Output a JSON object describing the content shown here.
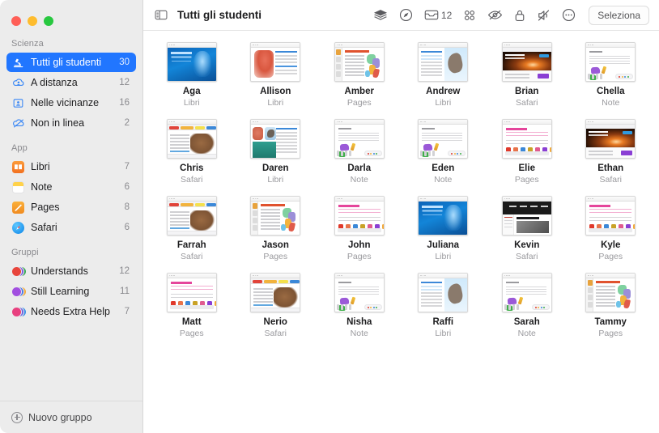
{
  "window": {
    "traffic_lights": [
      "close",
      "minimize",
      "zoom"
    ],
    "colors": {
      "accent": "#2176ff",
      "sidebar_bg": "#ececec",
      "main_bg": "#ffffff"
    }
  },
  "toolbar": {
    "sidebar_toggle_icon": "sidebar-icon",
    "title": "Tutti gli studenti",
    "actions": [
      {
        "icon": "layers-icon",
        "name": "layers-button",
        "label": ""
      },
      {
        "icon": "navigate-icon",
        "name": "navigate-button",
        "label": ""
      },
      {
        "icon": "inbox-icon",
        "name": "inbox-button",
        "label": "12"
      },
      {
        "icon": "grid-apps-icon",
        "name": "apps-button",
        "label": ""
      },
      {
        "icon": "eye-slash-icon",
        "name": "hide-screen-button",
        "label": ""
      },
      {
        "icon": "lock-icon",
        "name": "lock-button",
        "label": ""
      },
      {
        "icon": "mute-icon",
        "name": "mute-button",
        "label": ""
      },
      {
        "icon": "more-circle-icon",
        "name": "more-button",
        "label": ""
      }
    ],
    "select_label": "Seleziona"
  },
  "sidebar": {
    "sections": [
      {
        "title": "Scienza",
        "items": [
          {
            "icon": "microscope-icon",
            "label": "Tutti gli studenti",
            "count": "30",
            "selected": true
          },
          {
            "icon": "cloud-person-icon",
            "label": "A distanza",
            "count": "12",
            "selected": false
          },
          {
            "icon": "person-card-icon",
            "label": "Nelle vicinanze",
            "count": "16",
            "selected": false
          },
          {
            "icon": "cloud-slash-icon",
            "label": "Non in linea",
            "count": "2",
            "selected": false
          }
        ]
      },
      {
        "title": "App",
        "items": [
          {
            "icon": "books-app-icon",
            "label": "Libri",
            "count": "7",
            "color": "#f3782b",
            "selected": false
          },
          {
            "icon": "notes-app-icon",
            "label": "Note",
            "count": "6",
            "color": "#ffcc33",
            "selected": false
          },
          {
            "icon": "pages-app-icon",
            "label": "Pages",
            "count": "8",
            "color": "#f3932b",
            "selected": false
          },
          {
            "icon": "safari-app-icon",
            "label": "Safari",
            "count": "6",
            "color": "#1a8cf0",
            "selected": false
          }
        ]
      },
      {
        "title": "Gruppi",
        "items": [
          {
            "icon": "group-avatars-icon",
            "label": "Understands",
            "count": "12",
            "colors": [
              "#e8453c",
              "#7d5be0",
              "#3aa757"
            ],
            "selected": false
          },
          {
            "icon": "group-avatars-icon",
            "label": "Still Learning",
            "count": "11",
            "colors": [
              "#a24fe0",
              "#4a7be8",
              "#f2a93b"
            ],
            "selected": false
          },
          {
            "icon": "group-avatars-icon",
            "label": "Needs Extra Help",
            "count": "7",
            "colors": [
              "#e8407f",
              "#6b63e0",
              "#3c8fe8"
            ],
            "selected": false
          }
        ]
      }
    ],
    "footer": {
      "icon": "plus-circle-icon",
      "label": "Nuovo gruppo"
    }
  },
  "students": [
    {
      "name": "Aga",
      "app": "Libri",
      "art": "art-books-penguin"
    },
    {
      "name": "Allison",
      "app": "Libri",
      "art": "art-books-flam"
    },
    {
      "name": "Amber",
      "app": "Pages",
      "art": "art-pages-map"
    },
    {
      "name": "Andrew",
      "app": "Libri",
      "art": "art-books-dino"
    },
    {
      "name": "Brian",
      "app": "Safari",
      "art": "art-safari-dark"
    },
    {
      "name": "Chella",
      "app": "Note",
      "art": "art-note"
    },
    {
      "name": "Chris",
      "app": "Safari",
      "art": "art-safari-mam"
    },
    {
      "name": "Daren",
      "app": "Libri",
      "art": "art-books-sea"
    },
    {
      "name": "Darla",
      "app": "Note",
      "art": "art-note"
    },
    {
      "name": "Eden",
      "app": "Note",
      "art": "art-note"
    },
    {
      "name": "Elie",
      "app": "Pages",
      "art": "art-pages-pink"
    },
    {
      "name": "Ethan",
      "app": "Safari",
      "art": "art-safari-dark"
    },
    {
      "name": "Farrah",
      "app": "Safari",
      "art": "art-safari-mam"
    },
    {
      "name": "Jason",
      "app": "Pages",
      "art": "art-pages-map"
    },
    {
      "name": "John",
      "app": "Pages",
      "art": "art-pages-pink"
    },
    {
      "name": "Juliana",
      "app": "Libri",
      "art": "art-books-penguin"
    },
    {
      "name": "Kevin",
      "app": "Safari",
      "art": "art-safari-shake"
    },
    {
      "name": "Kyle",
      "app": "Pages",
      "art": "art-pages-pink"
    },
    {
      "name": "Matt",
      "app": "Pages",
      "art": "art-pages-pink"
    },
    {
      "name": "Nerio",
      "app": "Safari",
      "art": "art-safari-mam"
    },
    {
      "name": "Nisha",
      "app": "Note",
      "art": "art-note"
    },
    {
      "name": "Raffi",
      "app": "Libri",
      "art": "art-books-dino"
    },
    {
      "name": "Sarah",
      "app": "Note",
      "art": "art-note"
    },
    {
      "name": "Tammy",
      "app": "Pages",
      "art": "art-pages-map"
    }
  ]
}
